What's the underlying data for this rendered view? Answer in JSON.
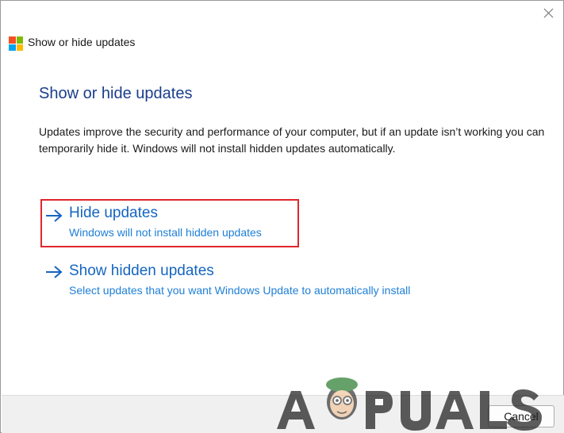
{
  "window": {
    "title": "Show or hide updates",
    "close_icon": "close-icon",
    "logo_colors": [
      "#f25022",
      "#7fba00",
      "#00a4ef",
      "#ffb900"
    ]
  },
  "main": {
    "heading": "Show or hide updates",
    "description": "Updates improve the security and performance of your computer, but if an update isn’t working you can temporarily hide it. Windows will not install hidden updates automatically.",
    "options": [
      {
        "icon": "arrow-right-icon",
        "title": "Hide updates",
        "subtitle": "Windows will not install hidden updates",
        "highlighted": true
      },
      {
        "icon": "arrow-right-icon",
        "title": "Show hidden updates",
        "subtitle": "Select updates that you want Windows Update to automatically install",
        "highlighted": false
      }
    ]
  },
  "footer": {
    "cancel_label": "Cancel"
  },
  "watermark": {
    "text": "APPUALS"
  },
  "colors": {
    "heading": "#1a3e8c",
    "link": "#1565c0",
    "highlight_border": "#e0262b"
  }
}
